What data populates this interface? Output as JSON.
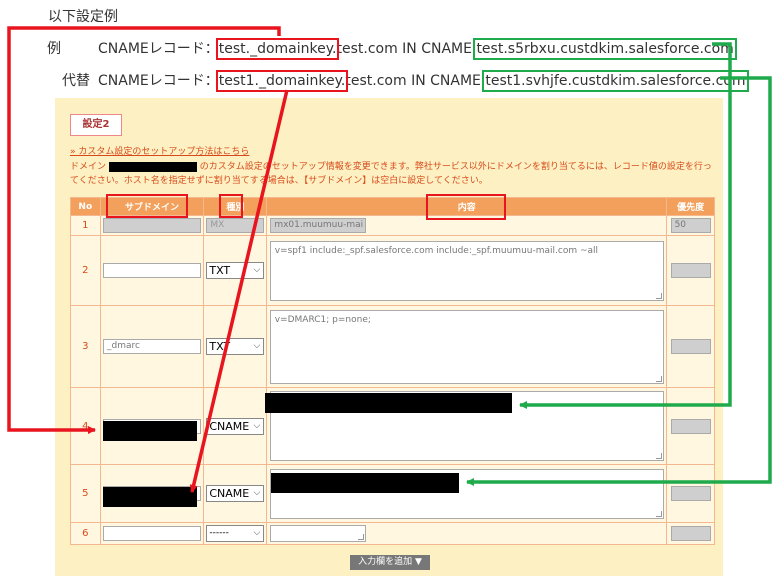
{
  "heading": "以下設定例",
  "example1": {
    "label": "例",
    "record_type": "CNAMEレコード：",
    "host": "test._domainkey.",
    "mid": "test.com IN CNAME ",
    "target": "test.s5rbxu.custdkim.salesforce.com"
  },
  "example2": {
    "label": "代替",
    "record_type": "CNAMEレコード：",
    "host": "test1._domainkey.",
    "mid": "test.com IN CNAME ",
    "target": "test1.svhjfe.custdkim.salesforce.com"
  },
  "settings": {
    "tab_label": "設定2",
    "guide_link": "» カスタム設定のセットアップ方法はこちら",
    "desc_prefix": "ドメイン",
    "desc_rest": "のカスタム設定のセットアップ情報を変更できます。弊社サービス以外にドメインを割り当てるには、レコード値の設定を行ってください。ホスト名を指定せずに割り当てする場合は、【サブドメイン】は空白に設定してください。",
    "add_row_button": "入力欄を追加 ▼"
  },
  "table": {
    "headers": {
      "no": "No",
      "subdomain": "サブドメイン",
      "type": "種別",
      "content": "内容",
      "priority": "優先度"
    },
    "rows": [
      {
        "no": "1",
        "subdomain": "",
        "type": "MX",
        "content": "mx01.muumuu-mai",
        "priority": "50"
      },
      {
        "no": "2",
        "subdomain": "",
        "type": "TXT",
        "content": "v=spf1 include:_spf.salesforce.com include:_spf.muumuu-mail.com ~all",
        "priority": ""
      },
      {
        "no": "3",
        "subdomain": "_dmarc",
        "type": "TXT",
        "content": "v=DMARC1; p=none;",
        "priority": ""
      },
      {
        "no": "4",
        "subdomain": "",
        "type": "CNAME",
        "content": "",
        "priority": ""
      },
      {
        "no": "5",
        "subdomain": "",
        "type": "CNAME",
        "content": "",
        "priority": ""
      },
      {
        "no": "6",
        "subdomain": "",
        "type": "------",
        "content": "",
        "priority": ""
      }
    ]
  },
  "colors": {
    "highlight_red": "#e8141e",
    "highlight_green": "#1faa4b",
    "panel_bg": "#fdf1c3",
    "header_orange": "#f2a05b"
  },
  "icons": {
    "select": "chevron-down-icon",
    "textarea": "resize-handle-icon"
  }
}
